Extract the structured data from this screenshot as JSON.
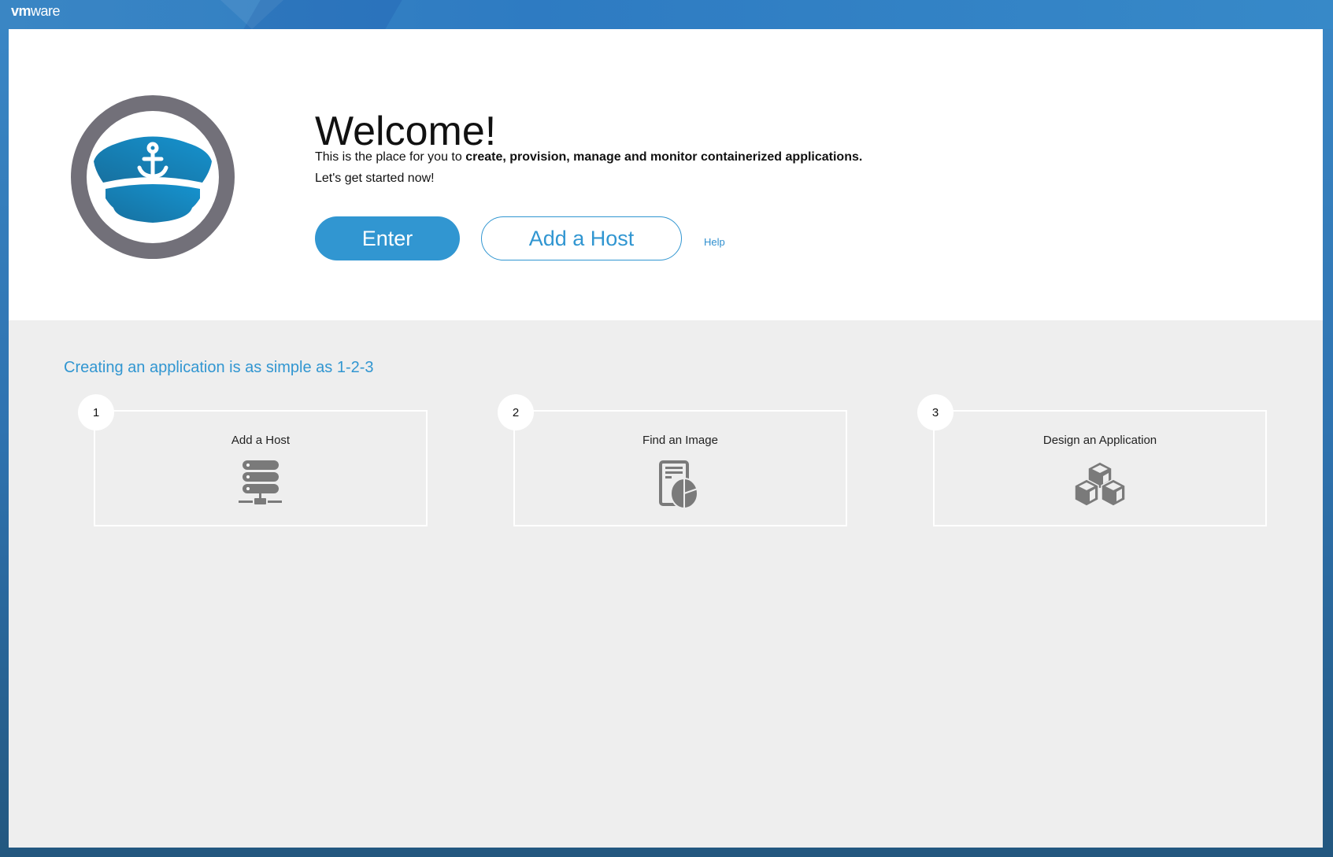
{
  "header": {
    "brand_bold": "vm",
    "brand_rest": "ware"
  },
  "hero": {
    "title": "Welcome!",
    "lead_plain": "This is the place for you to ",
    "lead_bold": "create, provision, manage and monitor containerized applications.",
    "lead_line2": "Let's get started now!",
    "enter_label": "Enter",
    "add_host_label": "Add a Host",
    "help_label": "Help"
  },
  "steps": {
    "heading": "Creating an application is as simple as 1-2-3",
    "items": [
      {
        "number": "1",
        "title": "Add a Host",
        "icon": "server-icon"
      },
      {
        "number": "2",
        "title": "Find an Image",
        "icon": "report-icon"
      },
      {
        "number": "3",
        "title": "Design an Application",
        "icon": "cubes-icon"
      }
    ]
  },
  "colors": {
    "accent": "#3196d1",
    "icon": "#7a7a7a",
    "badge_ring": "#727079",
    "hat": "#1a7fb4"
  }
}
